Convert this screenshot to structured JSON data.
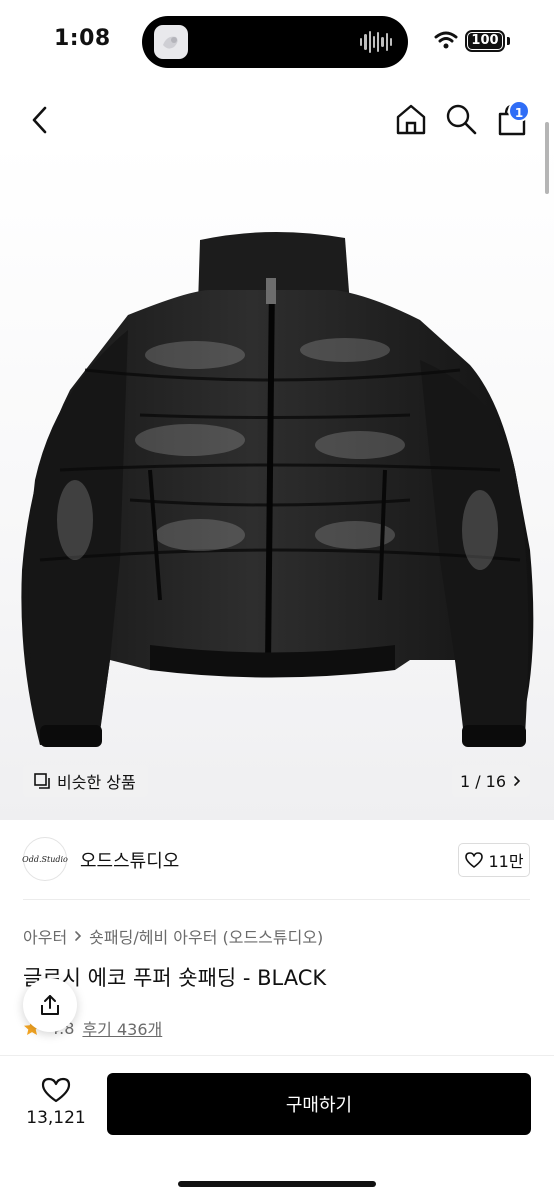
{
  "status_bar": {
    "time": "1:08",
    "battery": "100"
  },
  "nav": {
    "cart_count": "1",
    "icons": [
      "back-icon",
      "home-icon",
      "search-icon",
      "cart-icon"
    ]
  },
  "gallery": {
    "similar_label": "비슷한 상품",
    "pager": "1 / 16",
    "image_subject": "black glossy cropped puffer jacket"
  },
  "brand": {
    "logo_text": "Odd.Studio",
    "name": "오드스튜디오",
    "likes": "11만"
  },
  "product": {
    "breadcrumb": [
      "아우터",
      "숏패딩/헤비 아우터 (오드스튜디오)"
    ],
    "title": "글로시 에코 푸퍼 숏패딩 - BLACK",
    "rating": "4.8",
    "reviews": "후기 436개"
  },
  "bottom_bar": {
    "wish_count": "13,121",
    "buy_label": "구매하기"
  },
  "colors": {
    "accent_badge": "#2f6df6",
    "star": "#f5a623",
    "primary_button": "#000000"
  }
}
